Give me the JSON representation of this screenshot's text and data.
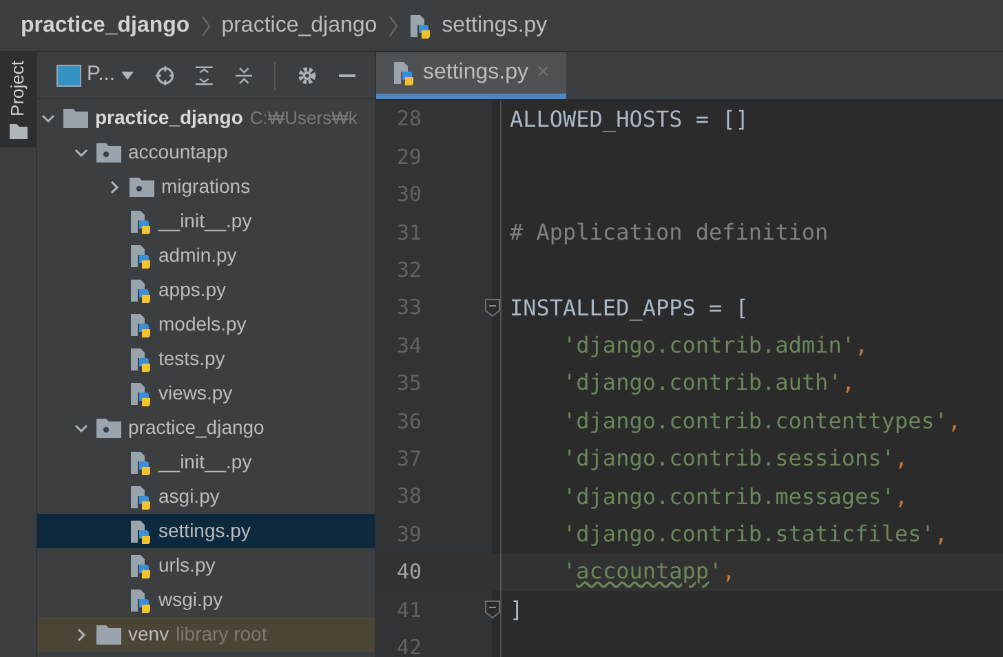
{
  "breadcrumb": [
    {
      "label": "practice_django",
      "kind": "project"
    },
    {
      "label": "practice_django",
      "kind": "folder"
    },
    {
      "label": "settings.py",
      "kind": "python"
    }
  ],
  "tool_strip": {
    "label": "Project"
  },
  "project_toolbar": {
    "view_label": "P..."
  },
  "tree": [
    {
      "label": "practice_django",
      "kind": "folder",
      "bold": true,
      "path": "C:₩Users₩k",
      "expanded": true,
      "selected": false,
      "children": [
        {
          "label": "accountapp",
          "kind": "package",
          "expanded": true,
          "selected": false,
          "children": [
            {
              "label": "migrations",
              "kind": "package",
              "expanded": false,
              "selected": false
            },
            {
              "label": "__init__.py",
              "kind": "python",
              "selected": false
            },
            {
              "label": "admin.py",
              "kind": "python",
              "selected": false
            },
            {
              "label": "apps.py",
              "kind": "python",
              "selected": false
            },
            {
              "label": "models.py",
              "kind": "python",
              "selected": false
            },
            {
              "label": "tests.py",
              "kind": "python",
              "selected": false
            },
            {
              "label": "views.py",
              "kind": "python",
              "selected": false
            }
          ]
        },
        {
          "label": "practice_django",
          "kind": "package",
          "expanded": true,
          "selected": false,
          "children": [
            {
              "label": "__init__.py",
              "kind": "python",
              "selected": false
            },
            {
              "label": "asgi.py",
              "kind": "python",
              "selected": false
            },
            {
              "label": "settings.py",
              "kind": "python",
              "selected": true
            },
            {
              "label": "urls.py",
              "kind": "python",
              "selected": false
            },
            {
              "label": "wsgi.py",
              "kind": "python",
              "selected": false
            }
          ]
        },
        {
          "label": "venv",
          "kind": "library",
          "note": "library root",
          "expanded": false,
          "selected": false
        }
      ]
    }
  ],
  "editor_tabs": [
    {
      "label": "settings.py",
      "selected": true,
      "close": "×"
    }
  ],
  "code_lines": [
    {
      "number": "28",
      "current": false,
      "fold": false,
      "tokens": [
        {
          "kind": "name",
          "text": "ALLOWED_HOSTS = []"
        }
      ]
    },
    {
      "number": "29",
      "current": false,
      "fold": false
    },
    {
      "number": "30",
      "current": false,
      "fold": false
    },
    {
      "number": "31",
      "current": false,
      "fold": false,
      "tokens": [
        {
          "kind": "comment",
          "text": "# Application definition"
        }
      ]
    },
    {
      "number": "32",
      "current": false,
      "fold": false
    },
    {
      "number": "33",
      "current": false,
      "fold": true,
      "tokens": [
        {
          "kind": "name",
          "text": "INSTALLED_APPS = ["
        }
      ]
    },
    {
      "number": "34",
      "current": false,
      "fold": false,
      "tokens": [
        {
          "kind": "string",
          "text": "    'django.contrib.admin'"
        },
        {
          "kind": "comma",
          "text": ","
        }
      ]
    },
    {
      "number": "35",
      "current": false,
      "fold": false,
      "tokens": [
        {
          "kind": "string",
          "text": "    'django.contrib.auth'"
        },
        {
          "kind": "comma",
          "text": ","
        }
      ]
    },
    {
      "number": "36",
      "current": false,
      "fold": false,
      "tokens": [
        {
          "kind": "string",
          "text": "    'django.contrib.contenttypes'"
        },
        {
          "kind": "comma",
          "text": ","
        }
      ]
    },
    {
      "number": "37",
      "current": false,
      "fold": false,
      "tokens": [
        {
          "kind": "string",
          "text": "    'django.contrib.sessions'"
        },
        {
          "kind": "comma",
          "text": ","
        }
      ]
    },
    {
      "number": "38",
      "current": false,
      "fold": false,
      "tokens": [
        {
          "kind": "string",
          "text": "    'django.contrib.messages'"
        },
        {
          "kind": "comma",
          "text": ","
        }
      ]
    },
    {
      "number": "39",
      "current": false,
      "fold": false,
      "tokens": [
        {
          "kind": "string",
          "text": "    'django.contrib.staticfiles'"
        },
        {
          "kind": "comma",
          "text": ","
        }
      ]
    },
    {
      "number": "40",
      "current": true,
      "fold": false,
      "tokens": [
        {
          "kind": "string",
          "text": "    '"
        },
        {
          "kind": "typo",
          "text": "accountapp"
        },
        {
          "kind": "string",
          "text": "'"
        },
        {
          "kind": "comma",
          "text": ","
        }
      ]
    },
    {
      "number": "41",
      "current": false,
      "fold": true,
      "tokens": [
        {
          "kind": "name",
          "text": "]"
        }
      ]
    },
    {
      "number": "42",
      "current": false,
      "fold": false
    }
  ]
}
